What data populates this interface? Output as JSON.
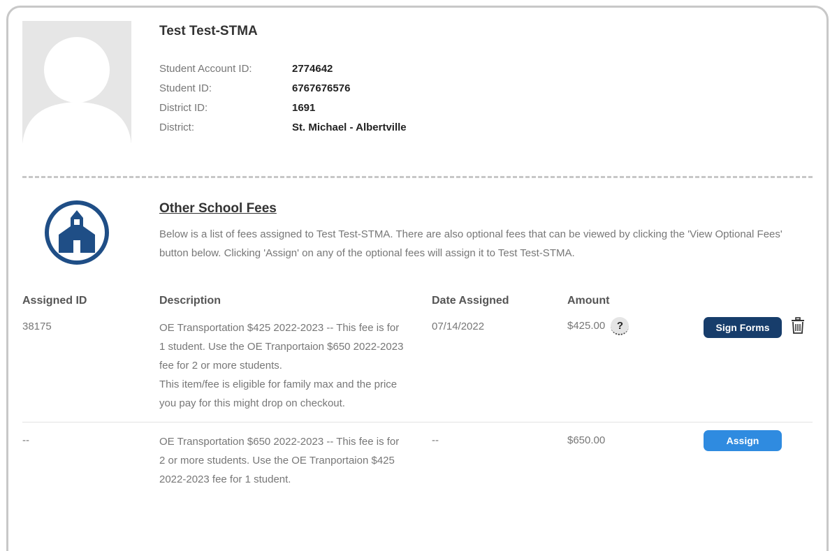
{
  "student": {
    "name": "Test Test-STMA",
    "fields": [
      {
        "label": "Student Account ID:",
        "value": "2774642"
      },
      {
        "label": "Student ID:",
        "value": "6767676576"
      },
      {
        "label": "District ID:",
        "value": "1691"
      },
      {
        "label": "District:",
        "value": "St. Michael - Albertville"
      }
    ]
  },
  "fees_section": {
    "title": "Other School Fees",
    "description": "Below is a list of fees assigned to Test Test-STMA. There are also optional fees that can be viewed by clicking the 'View Optional Fees' button below. Clicking 'Assign' on any of the optional fees will assign it to Test Test-STMA."
  },
  "table": {
    "headers": {
      "assigned_id": "Assigned ID",
      "description": "Description",
      "date_assigned": "Date Assigned",
      "amount": "Amount"
    },
    "rows": [
      {
        "assigned_id": "38175",
        "description": "OE Transportation $425 2022-2023 -- This fee is for 1 student. Use the OE Tranportaion $650 2022-2023 fee for 2 or more students.",
        "note": "This item/fee is eligible for family max and the price you pay for this might drop on checkout.",
        "date_assigned": "07/14/2022",
        "amount": "$425.00",
        "help": "?",
        "action": "Sign Forms"
      },
      {
        "assigned_id": "--",
        "description": "OE Transportation $650 2022-2023 -- This fee is for 2 or more students. Use the OE Tranportaion $425 2022-2023 fee for 1 student.",
        "date_assigned": "--",
        "amount": "$650.00",
        "action": "Assign"
      }
    ]
  },
  "colors": {
    "navy": "#173d6b",
    "blue": "#2f8be0",
    "icon_blue": "#1f4e86"
  },
  "icons": {
    "avatar": "user-silhouette-icon",
    "school": "schoolhouse-icon",
    "delete": "trash-icon"
  }
}
